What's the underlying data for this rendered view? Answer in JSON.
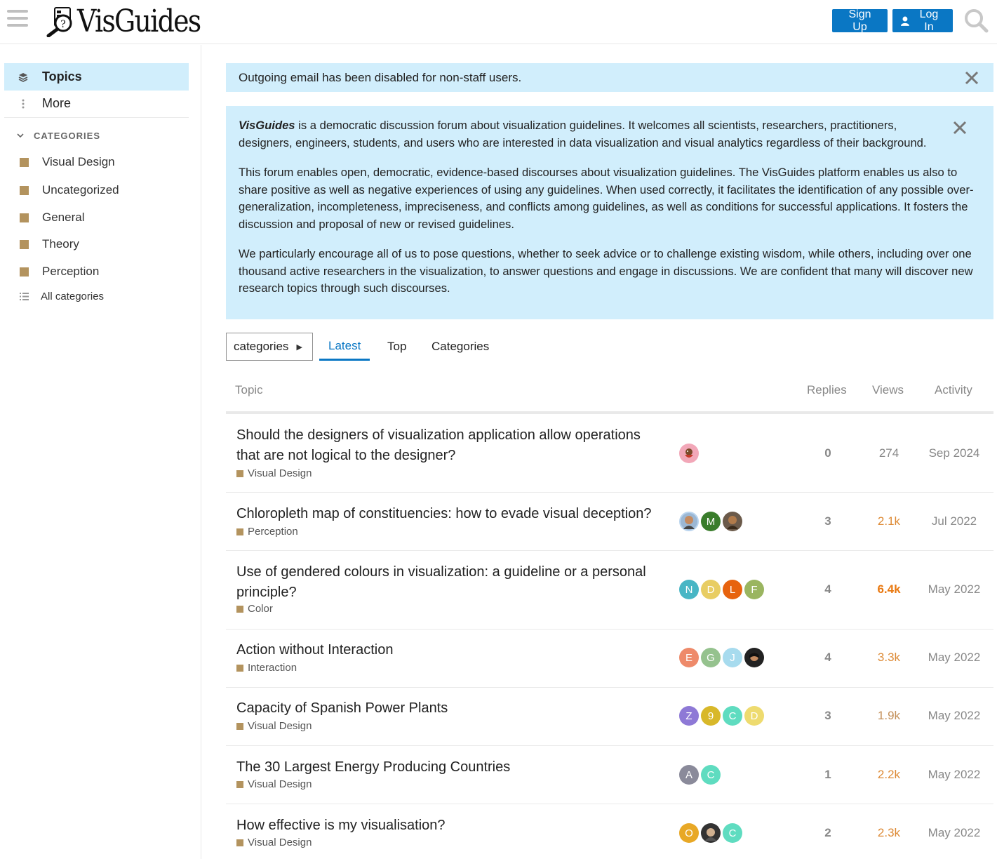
{
  "header": {
    "logo_text": "VisGuides",
    "signup_label": "Sign Up",
    "login_label": "Log In"
  },
  "sidebar": {
    "topics_label": "Topics",
    "more_label": "More",
    "categories_header": "CATEGORIES",
    "categories": [
      {
        "label": "Visual Design"
      },
      {
        "label": "Uncategorized"
      },
      {
        "label": "General"
      },
      {
        "label": "Theory"
      },
      {
        "label": "Perception"
      }
    ],
    "all_categories_label": "All categories"
  },
  "banners": {
    "email_notice": "Outgoing email has been disabled for non-staff users.",
    "welcome_brand": "VisGuides",
    "welcome_p1": " is a democratic discussion forum about visualization guidelines. It welcomes all scientists, researchers, practitioners, designers, engineers, students, and users who are interested in data visualization and visual analytics regardless of their background.",
    "welcome_p2": "This forum enables open, democratic, evidence-based discourses about visualization guidelines. The VisGuides platform enables us also to share positive as well as negative experiences of using any guidelines. When used correctly, it facilitates the identification of any possible over-generalization, incompleteness, impreciseness, and conflicts among guidelines, as well as conditions for successful applications. It fosters the discussion and proposal of new or revised guidelines.",
    "welcome_p3": "We particularly encourage all of us to pose questions, whether to seek advice or to challenge existing wisdom, while others, including over one thousand active researchers in the visualization, to answer questions and engage in discussions. We are confident that many will discover new research topics through such discourses."
  },
  "nav": {
    "dropdown_label": "categories",
    "tabs": [
      {
        "label": "Latest"
      },
      {
        "label": "Top"
      },
      {
        "label": "Categories"
      }
    ]
  },
  "table": {
    "headers": {
      "topic": "Topic",
      "replies": "Replies",
      "views": "Views",
      "activity": "Activity"
    },
    "rows": [
      {
        "title": "Should the designers of visualization application allow operations that are not logical to the designer?",
        "category": "Visual Design",
        "replies": "0",
        "views": "274",
        "activity": "Sep 2024"
      },
      {
        "title": "Chloropleth map of constituencies: how to evade visual deception?",
        "category": "Perception",
        "replies": "3",
        "views": "2.1k",
        "activity": "Jul 2022"
      },
      {
        "title": "Use of gendered colours in visualization: a guideline or a personal principle?",
        "category": "Color",
        "replies": "4",
        "views": "6.4k",
        "activity": "May 2022"
      },
      {
        "title": "Action without Interaction",
        "category": "Interaction",
        "replies": "4",
        "views": "3.3k",
        "activity": "May 2022"
      },
      {
        "title": "Capacity of Spanish Power Plants",
        "category": "Visual Design",
        "replies": "3",
        "views": "1.9k",
        "activity": "May 2022"
      },
      {
        "title": "The 30 Largest Energy Producing Countries",
        "category": "Visual Design",
        "replies": "1",
        "views": "2.2k",
        "activity": "May 2022"
      },
      {
        "title": "How effective is my visualisation?",
        "category": "Visual Design",
        "replies": "2",
        "views": "2.3k",
        "activity": "May 2022"
      }
    ],
    "avatars": {
      "r2": [
        "M"
      ],
      "r3": [
        "N",
        "D",
        "L",
        "F"
      ],
      "r4": [
        "E",
        "G",
        "J"
      ],
      "r5": [
        "Z",
        "9",
        "C",
        "D"
      ],
      "r6": [
        "A",
        "C"
      ],
      "r7": [
        "O",
        "C"
      ]
    }
  },
  "colors": {
    "accent": "#0a77c4",
    "banner_bg": "#d1eefc",
    "category_square": "#b3935e",
    "views_hot": "#e9780f",
    "views_warm": "#dd8a35"
  }
}
